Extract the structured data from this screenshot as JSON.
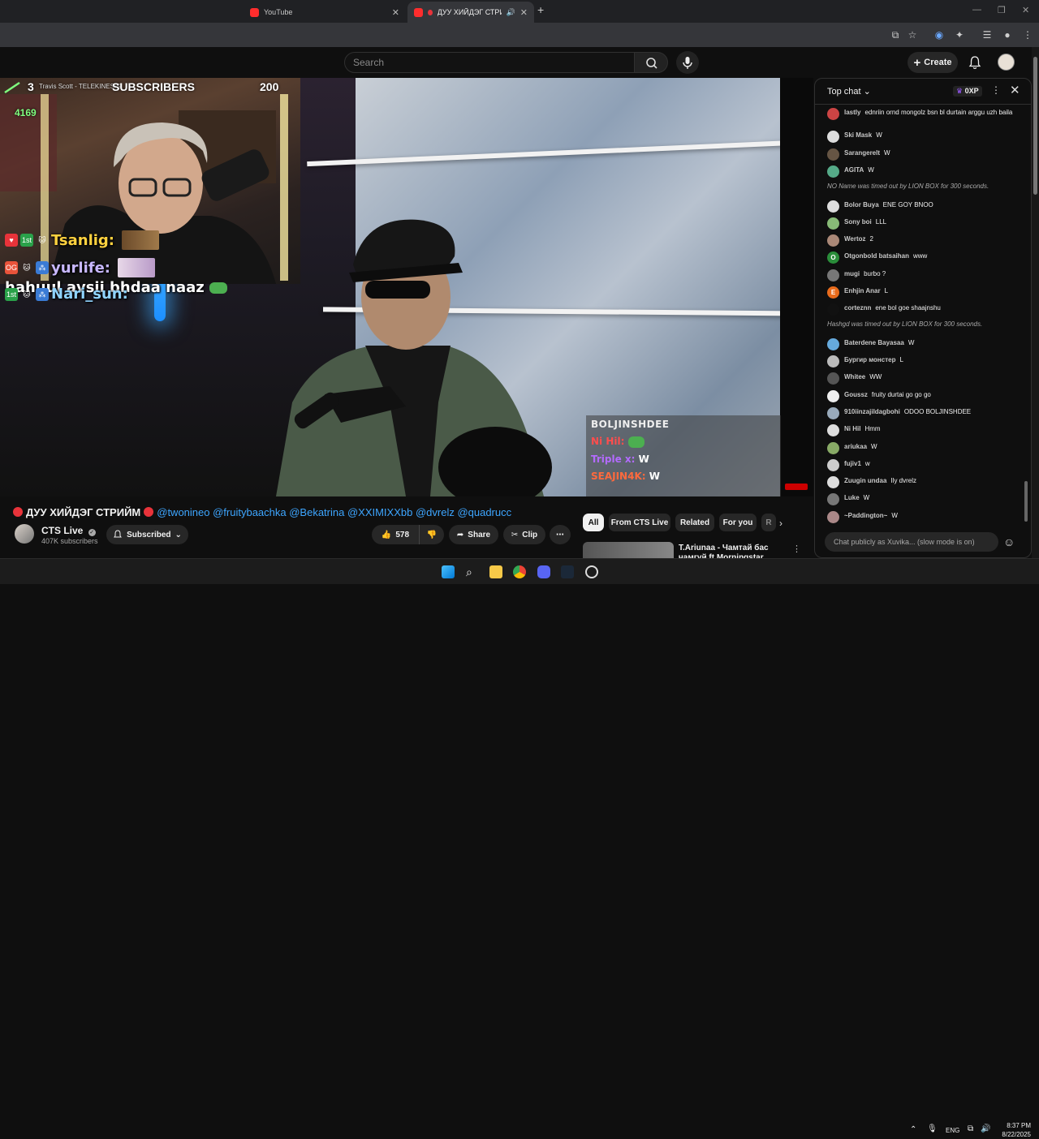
{
  "browser": {
    "tabs": [
      {
        "label": "YouTube",
        "active": false
      },
      {
        "label": "ДУУ ХИЙДЭГ СТРИЙМ",
        "active": true
      }
    ],
    "close_glyph": "✕",
    "new_tab_glyph": "+",
    "window_controls": [
      "—",
      "❐",
      "✕"
    ]
  },
  "header": {
    "search_placeholder": "Search",
    "create_label": "Create"
  },
  "stream_overlay": {
    "rank": "3",
    "now_playing": "Travis Scott - TELEKINESIS",
    "subs_label": "SUBSCRIBERS",
    "subs_count": "200",
    "live_count": "4169",
    "chat_message": "hahuul avsii bhdaa naaz",
    "chat_rows": [
      {
        "badge": "1st",
        "name": "Tsanlig:",
        "color": "#ffd23f"
      },
      {
        "badge": "OG",
        "name": "yurlife:",
        "color": "#c8b8ff"
      },
      {
        "badge": "1st",
        "name": "Nari_sun:",
        "color": "#8fd3ff"
      }
    ],
    "inv_chat": {
      "header": "BOLJINSHDEE",
      "rows": [
        {
          "name": "Ni Hil:",
          "text": "",
          "color": "#ff4d4d"
        },
        {
          "name": "Triple x:",
          "text": "W",
          "color": "#b36bff"
        },
        {
          "name": "SEAJIN4K:",
          "text": "W",
          "color": "#ff6a3d"
        }
      ]
    }
  },
  "video": {
    "title_prefix": "ДУУ ХИЙДЭГ СТРИЙМ",
    "mentions": "@twonineo @fruitybaachka @Bekatrina @XXIMIXXbb @dvrelz @quadrucc",
    "channel_name": "CTS Live",
    "channel_subs": "407K subscribers",
    "subscribed_label": "Subscribed",
    "like_count": "578",
    "share_label": "Share",
    "clip_label": "Clip"
  },
  "chips": [
    "All",
    "From CTS Live",
    "Related",
    "For you",
    "R"
  ],
  "recommendation": {
    "title": "T.Ariunaa - Чамтай бас чамгүй ft.Morningstar (Official Video)"
  },
  "chat": {
    "title": "Top chat",
    "xp_label": "0XP",
    "input_placeholder": "Chat publicly as Xuvika... (slow mode is on)",
    "messages": [
      {
        "author": "lastly",
        "text": "ednriin ornd mongolz bsn bl durtain arggu uzh baila",
        "avatar": "#c44"
      },
      {
        "author": "Ski Mask",
        "text": "W",
        "avatar": "#ddd"
      },
      {
        "author": "Sarangerelt",
        "text": "W",
        "avatar": "#654"
      },
      {
        "author": "AGITA",
        "text": "W",
        "avatar": "#5a8"
      },
      {
        "system": "NO Name was timed out by LION BOX for 300 seconds."
      },
      {
        "author": "Bolor Buya",
        "text": "ENE GOY BNOO",
        "avatar": "#ddd"
      },
      {
        "author": "Sony boi",
        "text": "LLL",
        "avatar": "#8b7"
      },
      {
        "author": "Wertoz",
        "text": "2",
        "avatar": "#a87"
      },
      {
        "author": "Otgonbold batsaihan",
        "text": "www",
        "avatar": "#2a8d3a",
        "initial": "O"
      },
      {
        "author": "mugi",
        "text": "burbo ?",
        "avatar": "#777"
      },
      {
        "author": "Enhjin Anar",
        "text": "L",
        "avatar": "#e86b1c",
        "initial": "E"
      },
      {
        "author": "corteznn",
        "text": "ene bol goe shaajnshu",
        "avatar": "#111"
      },
      {
        "system": "Hashgd was timed out by LION BOX for 300 seconds."
      },
      {
        "author": "Baterdene Bayasaa",
        "text": "W",
        "avatar": "#6ad"
      },
      {
        "author": "Бургир монстер",
        "text": "L",
        "avatar": "#bbb"
      },
      {
        "author": "Whitee",
        "text": "WW",
        "avatar": "#555"
      },
      {
        "author": "Goussz",
        "text": "fruity durtai go go go",
        "avatar": "#eee"
      },
      {
        "author": "910iinzajildagbohi",
        "text": "ODOO BOLJINSHDEE",
        "avatar": "#9ab"
      },
      {
        "author": "Ni Hil",
        "text": "Hmm",
        "avatar": "#ddd"
      },
      {
        "author": "ariukaa",
        "text": "W",
        "avatar": "#8a6"
      },
      {
        "author": "fujiv1",
        "text": "w",
        "avatar": "#ccc"
      },
      {
        "author": "Zuugin undaa",
        "text": "Ily dvrelz",
        "avatar": "#ddd"
      },
      {
        "author": "Luke",
        "text": "W",
        "avatar": "#777"
      },
      {
        "author": "~Paddington~",
        "text": "W",
        "avatar": "#a88"
      }
    ]
  },
  "taskbar": {
    "lang": "ENG",
    "time": "8:37 PM",
    "date": "8/22/2025"
  }
}
